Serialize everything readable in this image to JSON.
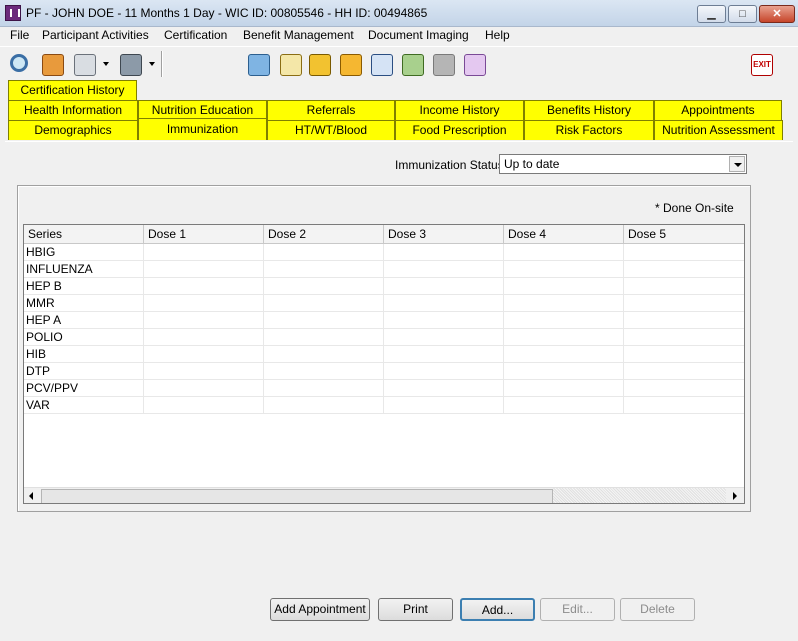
{
  "window": {
    "title": "PF - JOHN DOE - 11 Months 1 Day - WIC ID: 00805546 - HH ID: 00494865",
    "minimize_glyph": "▁",
    "maximize_glyph": "□",
    "close_glyph": "✕"
  },
  "menu": [
    "File",
    "Participant Activities",
    "Certification",
    "Benefit Management",
    "Document Imaging",
    "Help"
  ],
  "toolbar": {
    "icons": [
      "search-icon",
      "participants-icon",
      "printer-icon",
      "tools-icon",
      "map-icon",
      "calendar-icon",
      "alert-icon",
      "note-icon",
      "certificate-icon",
      "checkbook-icon",
      "card-reader-icon",
      "folder-icon",
      "exit-icon"
    ],
    "exit_label": "EXIT"
  },
  "tabs": {
    "row_top": [
      "Certification History"
    ],
    "row_middle": [
      "Health Information",
      "Nutrition Education",
      "Referrals",
      "Income History",
      "Benefits History",
      "Appointments"
    ],
    "row_bottom": [
      "Demographics",
      "Immunization",
      "HT/WT/Blood",
      "Food Prescription",
      "Risk Factors",
      "Nutrition Assessment"
    ],
    "selected": "Immunization",
    "color": "#ffff00"
  },
  "immunization": {
    "status_label": "Immunization Status",
    "status_value": "Up to date",
    "note": "* Done On-site",
    "columns": [
      "Series",
      "Dose 1",
      "Dose 2",
      "Dose 3",
      "Dose 4",
      "Dose 5"
    ],
    "rows": [
      "HBIG",
      "INFLUENZA",
      "HEP B",
      "MMR",
      "HEP A",
      "POLIO",
      "HIB",
      "DTP",
      "PCV/PPV",
      "VAR"
    ]
  },
  "buttons": {
    "add_appointment": "Add Appointment",
    "print": "Print",
    "add": "Add...",
    "edit": "Edit...",
    "delete": "Delete"
  }
}
